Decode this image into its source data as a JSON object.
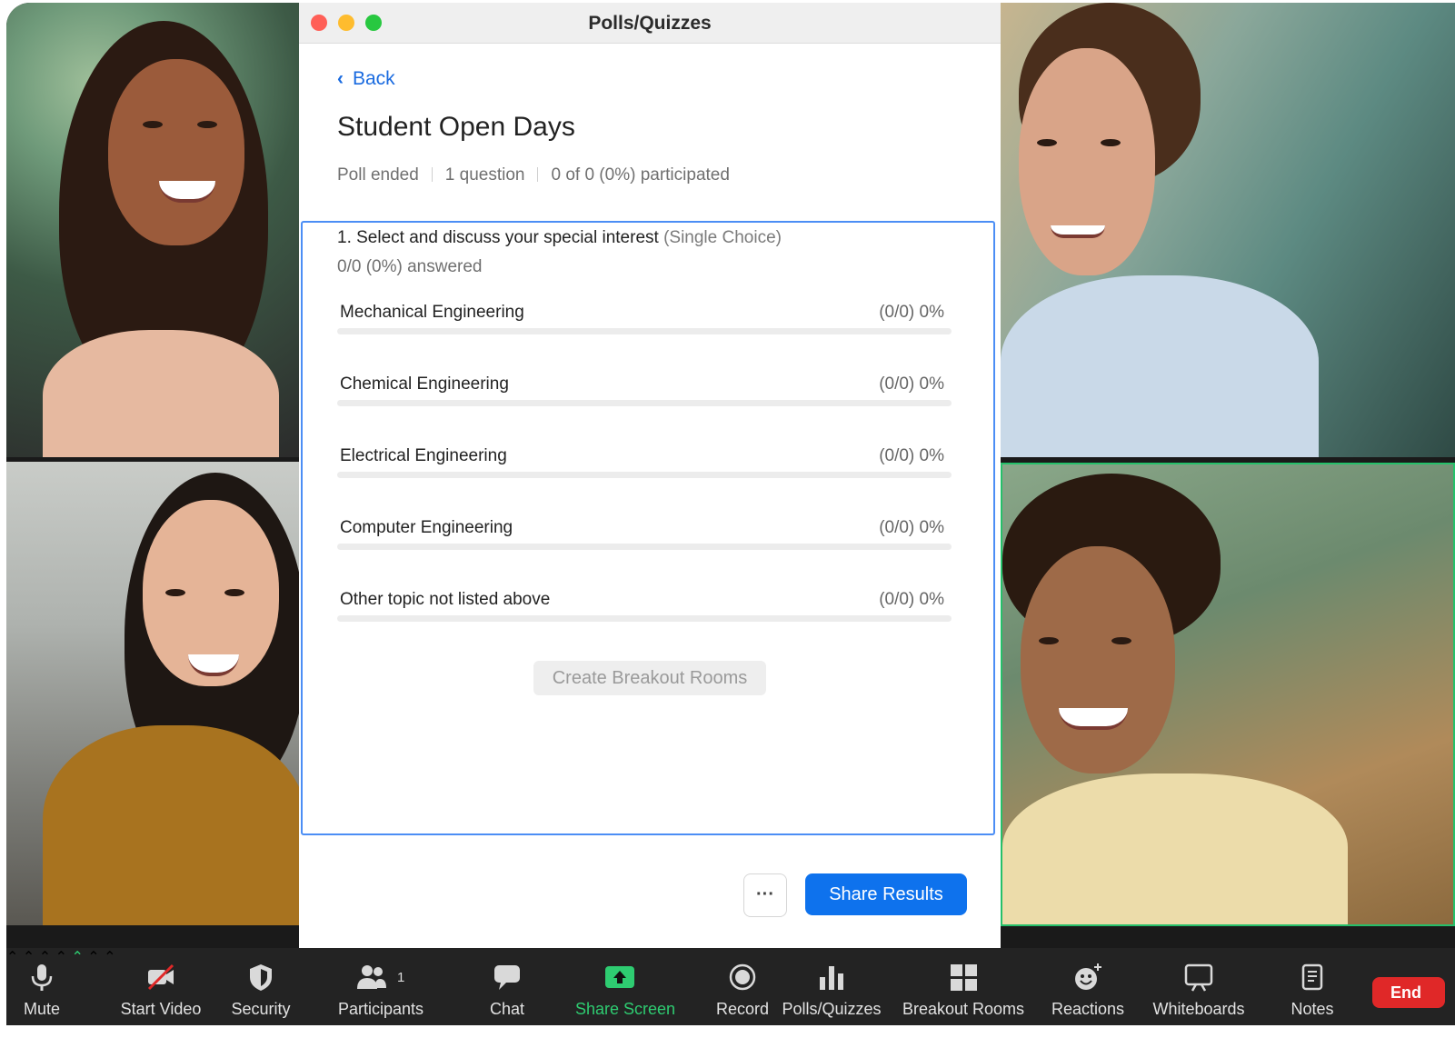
{
  "window": {
    "title": "Polls/Quizzes",
    "traffic_lights": {
      "close": "#ff5f57",
      "minimize": "#febc2e",
      "maximize": "#28c840"
    }
  },
  "poll": {
    "back_label": "Back",
    "title": "Student Open Days",
    "status": "Poll ended",
    "question_count": "1 question",
    "participation": "0 of 0 (0%) participated",
    "question": {
      "text": "1. Select and discuss your special interest",
      "type": "(Single Choice)",
      "answered": "0/0 (0%) answered",
      "options": [
        {
          "label": "Mechanical Engineering",
          "result": "(0/0) 0%",
          "fraction": 0
        },
        {
          "label": "Chemical Engineering",
          "result": "(0/0) 0%",
          "fraction": 0
        },
        {
          "label": "Electrical Engineering",
          "result": "(0/0) 0%",
          "fraction": 0
        },
        {
          "label": "Computer Engineering",
          "result": "(0/0) 0%",
          "fraction": 0
        },
        {
          "label": "Other topic not listed above",
          "result": "(0/0) 0%",
          "fraction": 0
        }
      ]
    },
    "breakout_button": "Create Breakout Rooms",
    "more_button": "···",
    "share_button": "Share Results"
  },
  "toolbar": {
    "mute": "Mute",
    "start_video": "Start Video",
    "security": "Security",
    "participants": "Participants",
    "participants_count": "1",
    "chat": "Chat",
    "share_screen": "Share Screen",
    "record": "Record",
    "polls": "Polls/Quizzes",
    "breakout_rooms": "Breakout Rooms",
    "reactions": "Reactions",
    "whiteboards": "Whiteboards",
    "notes": "Notes",
    "end": "End"
  },
  "colors": {
    "accent_blue": "#0e72ed",
    "share_green": "#2ecc71",
    "end_red": "#e02828",
    "active_speaker_border": "#25c06a"
  }
}
